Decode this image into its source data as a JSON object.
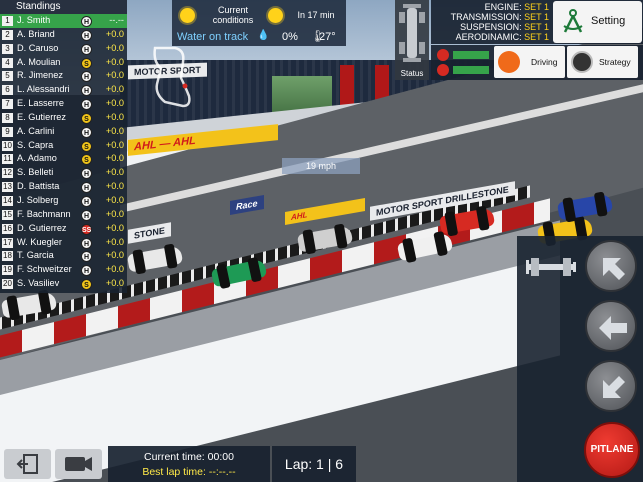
{
  "standings": {
    "title": "Standings",
    "rows": [
      {
        "pos": "1",
        "name": "J. Smith",
        "tyre": "H",
        "gap": "--.--",
        "me": true
      },
      {
        "pos": "2",
        "name": "A. Briand",
        "tyre": "H",
        "gap": "+0.0"
      },
      {
        "pos": "3",
        "name": "D. Caruso",
        "tyre": "H",
        "gap": "+0.0"
      },
      {
        "pos": "4",
        "name": "A. Moulian",
        "tyre": "S",
        "gap": "+0.0"
      },
      {
        "pos": "5",
        "name": "R. Jimenez",
        "tyre": "H",
        "gap": "+0.0"
      },
      {
        "pos": "6",
        "name": "L. Alessandri",
        "tyre": "H",
        "gap": "+0.0"
      },
      {
        "pos": "7",
        "name": "E. Lasserre",
        "tyre": "H",
        "gap": "+0.0"
      },
      {
        "pos": "8",
        "name": "E. Gutierrez",
        "tyre": "S",
        "gap": "+0.0"
      },
      {
        "pos": "9",
        "name": "A. Carlini",
        "tyre": "H",
        "gap": "+0.0"
      },
      {
        "pos": "10",
        "name": "S. Capra",
        "tyre": "S",
        "gap": "+0.0"
      },
      {
        "pos": "11",
        "name": "A. Adamo",
        "tyre": "S",
        "gap": "+0.0"
      },
      {
        "pos": "12",
        "name": "S. Belleti",
        "tyre": "H",
        "gap": "+0.0"
      },
      {
        "pos": "13",
        "name": "D. Battista",
        "tyre": "H",
        "gap": "+0.0"
      },
      {
        "pos": "14",
        "name": "J. Solberg",
        "tyre": "H",
        "gap": "+0.0"
      },
      {
        "pos": "15",
        "name": "F. Bachmann",
        "tyre": "H",
        "gap": "+0.0"
      },
      {
        "pos": "16",
        "name": "D. Gutierrez",
        "tyre": "SS",
        "gap": "+0.0"
      },
      {
        "pos": "17",
        "name": "W. Kuegler",
        "tyre": "H",
        "gap": "+0.0"
      },
      {
        "pos": "18",
        "name": "T. Garcia",
        "tyre": "H",
        "gap": "+0.0"
      },
      {
        "pos": "19",
        "name": "F. Schweitzer",
        "tyre": "H",
        "gap": "+0.0"
      },
      {
        "pos": "20",
        "name": "S. Vasiliev",
        "tyre": "S",
        "gap": "+0.0"
      }
    ]
  },
  "conditions": {
    "current_label_1": "Current",
    "current_label_2": "conditions",
    "forecast_label": "In 17 min",
    "water_label": "Water on track",
    "rain_percent": "0%",
    "temperature": "27°",
    "sun_icon": "sun-icon"
  },
  "status": {
    "label": "Status"
  },
  "setup": {
    "engine_label": "ENGINE:",
    "engine_value": "SET 1",
    "transmission_label": "TRANSMISSION:",
    "transmission_value": "SET 1",
    "suspension_label": "SUSPENSION:",
    "suspension_value": "SET 1",
    "aero_label": "AERODINAMIC:",
    "aero_value": "SET 1",
    "setting_label": "Setting"
  },
  "buttons": {
    "driving_label": "Driving",
    "strategy_label": "Strategy",
    "pitlane_label": "PITLANE"
  },
  "speed": "19 mph",
  "timing": {
    "current_time": "Current time: 00:00",
    "best_lap": "Best lap time: --:--.--"
  },
  "lap": "Lap: 1 | 6",
  "banners": {
    "motorsport": "MOTOR SPORT",
    "drillestone": "DRILLESTONE",
    "ahl": "AHL",
    "stone": "STONE",
    "race": "Race"
  },
  "colors": {
    "panel": "#182230",
    "leader_highlight": "#36a34a",
    "gap_text": "#ffe948",
    "pitlane": "#d62a22",
    "setup_value": "#ffd21a"
  }
}
